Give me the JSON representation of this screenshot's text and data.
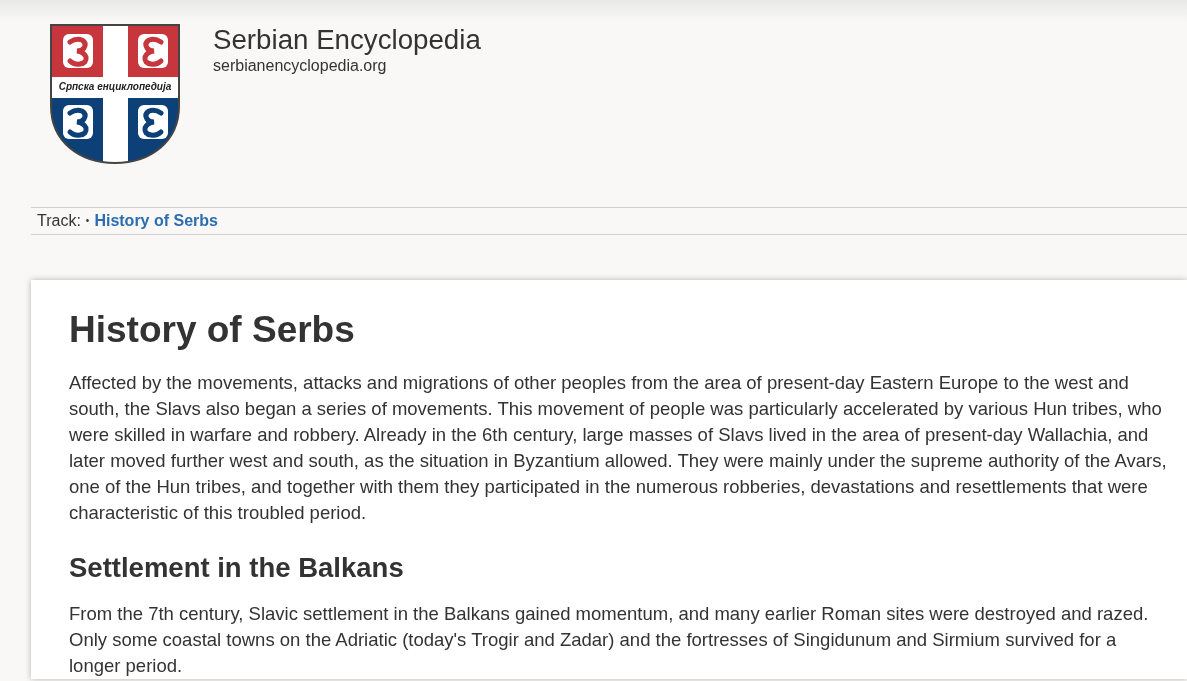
{
  "site": {
    "logo_caption": "Српска енциклопедија",
    "title": "Serbian Encyclopedia",
    "url": "serbianencyclopedia.org"
  },
  "breadcrumb": {
    "label": "Track:",
    "separator": "•",
    "items": [
      {
        "label": "History of Serbs"
      }
    ]
  },
  "article": {
    "title": "History of Serbs",
    "blocks": [
      {
        "kind": "paragraph",
        "text": "Affected by the movements, attacks and migrations of other peoples from the area of present-day Eastern Europe to the west and south, the Slavs also began a series of movements. This movement of people was particularly accelerated by various Hun tribes, who were skilled in warfare and robbery. Already in the 6th century, large masses of Slavs lived in the area of present-day Wallachia, and later moved further west and south, as the situation in Byzantium allowed. They were mainly under the supreme authority of the Avars, one of the Hun tribes, and together with them they participated in the numerous robberies, devastations and resettlements that were characteristic of this troubled period."
      },
      {
        "kind": "heading",
        "text": "Settlement in the Balkans"
      },
      {
        "kind": "paragraph",
        "text": "From the 7th century, Slavic settlement in the Balkans gained momentum, and many earlier Roman sites were destroyed and razed. Only some coastal towns on the Adriatic (today's Trogir and Zadar) and the fortresses of Singidunum and Sirmium survived for a longer period."
      }
    ]
  }
}
